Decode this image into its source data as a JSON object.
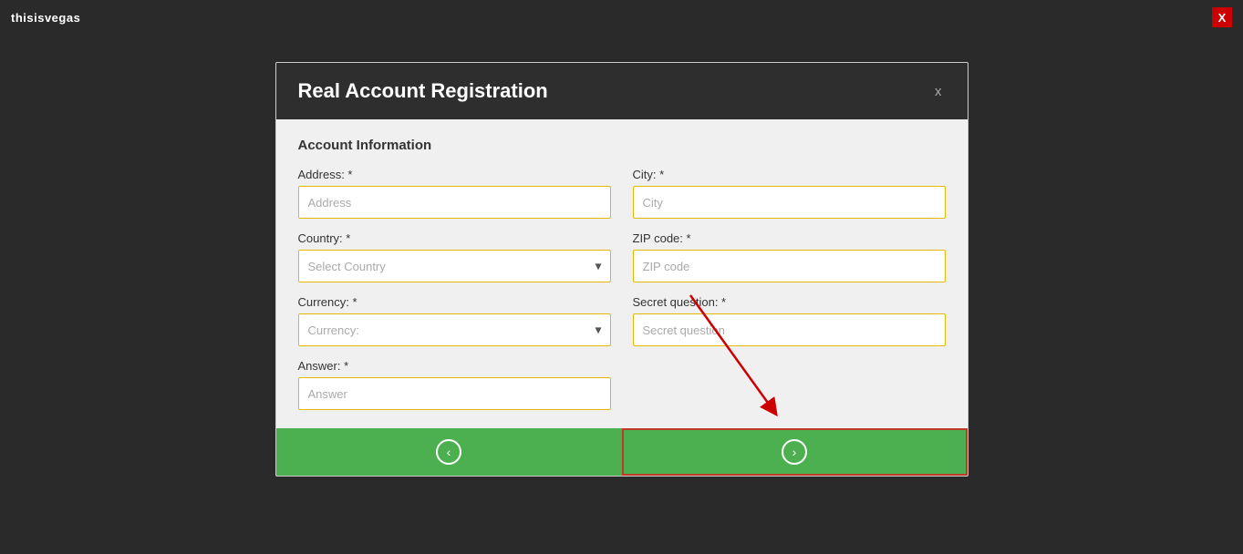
{
  "topbar": {
    "logo": "thisisvegas",
    "close_label": "X"
  },
  "modal": {
    "title": "Real Account Registration",
    "close_btn_label": "x",
    "section_title": "Account Information",
    "fields": {
      "address_label": "Address: *",
      "address_placeholder": "Address",
      "city_label": "City: *",
      "city_placeholder": "City",
      "country_label": "Country: *",
      "country_placeholder": "Select Country",
      "zip_label": "ZIP code: *",
      "zip_placeholder": "ZIP code",
      "currency_label": "Currency: *",
      "currency_placeholder": "Currency:",
      "secret_question_label": "Secret question: *",
      "secret_question_placeholder": "Secret question",
      "answer_label": "Answer: *",
      "answer_placeholder": "Answer"
    },
    "footer": {
      "back_btn": "‹",
      "next_btn": "›"
    }
  }
}
